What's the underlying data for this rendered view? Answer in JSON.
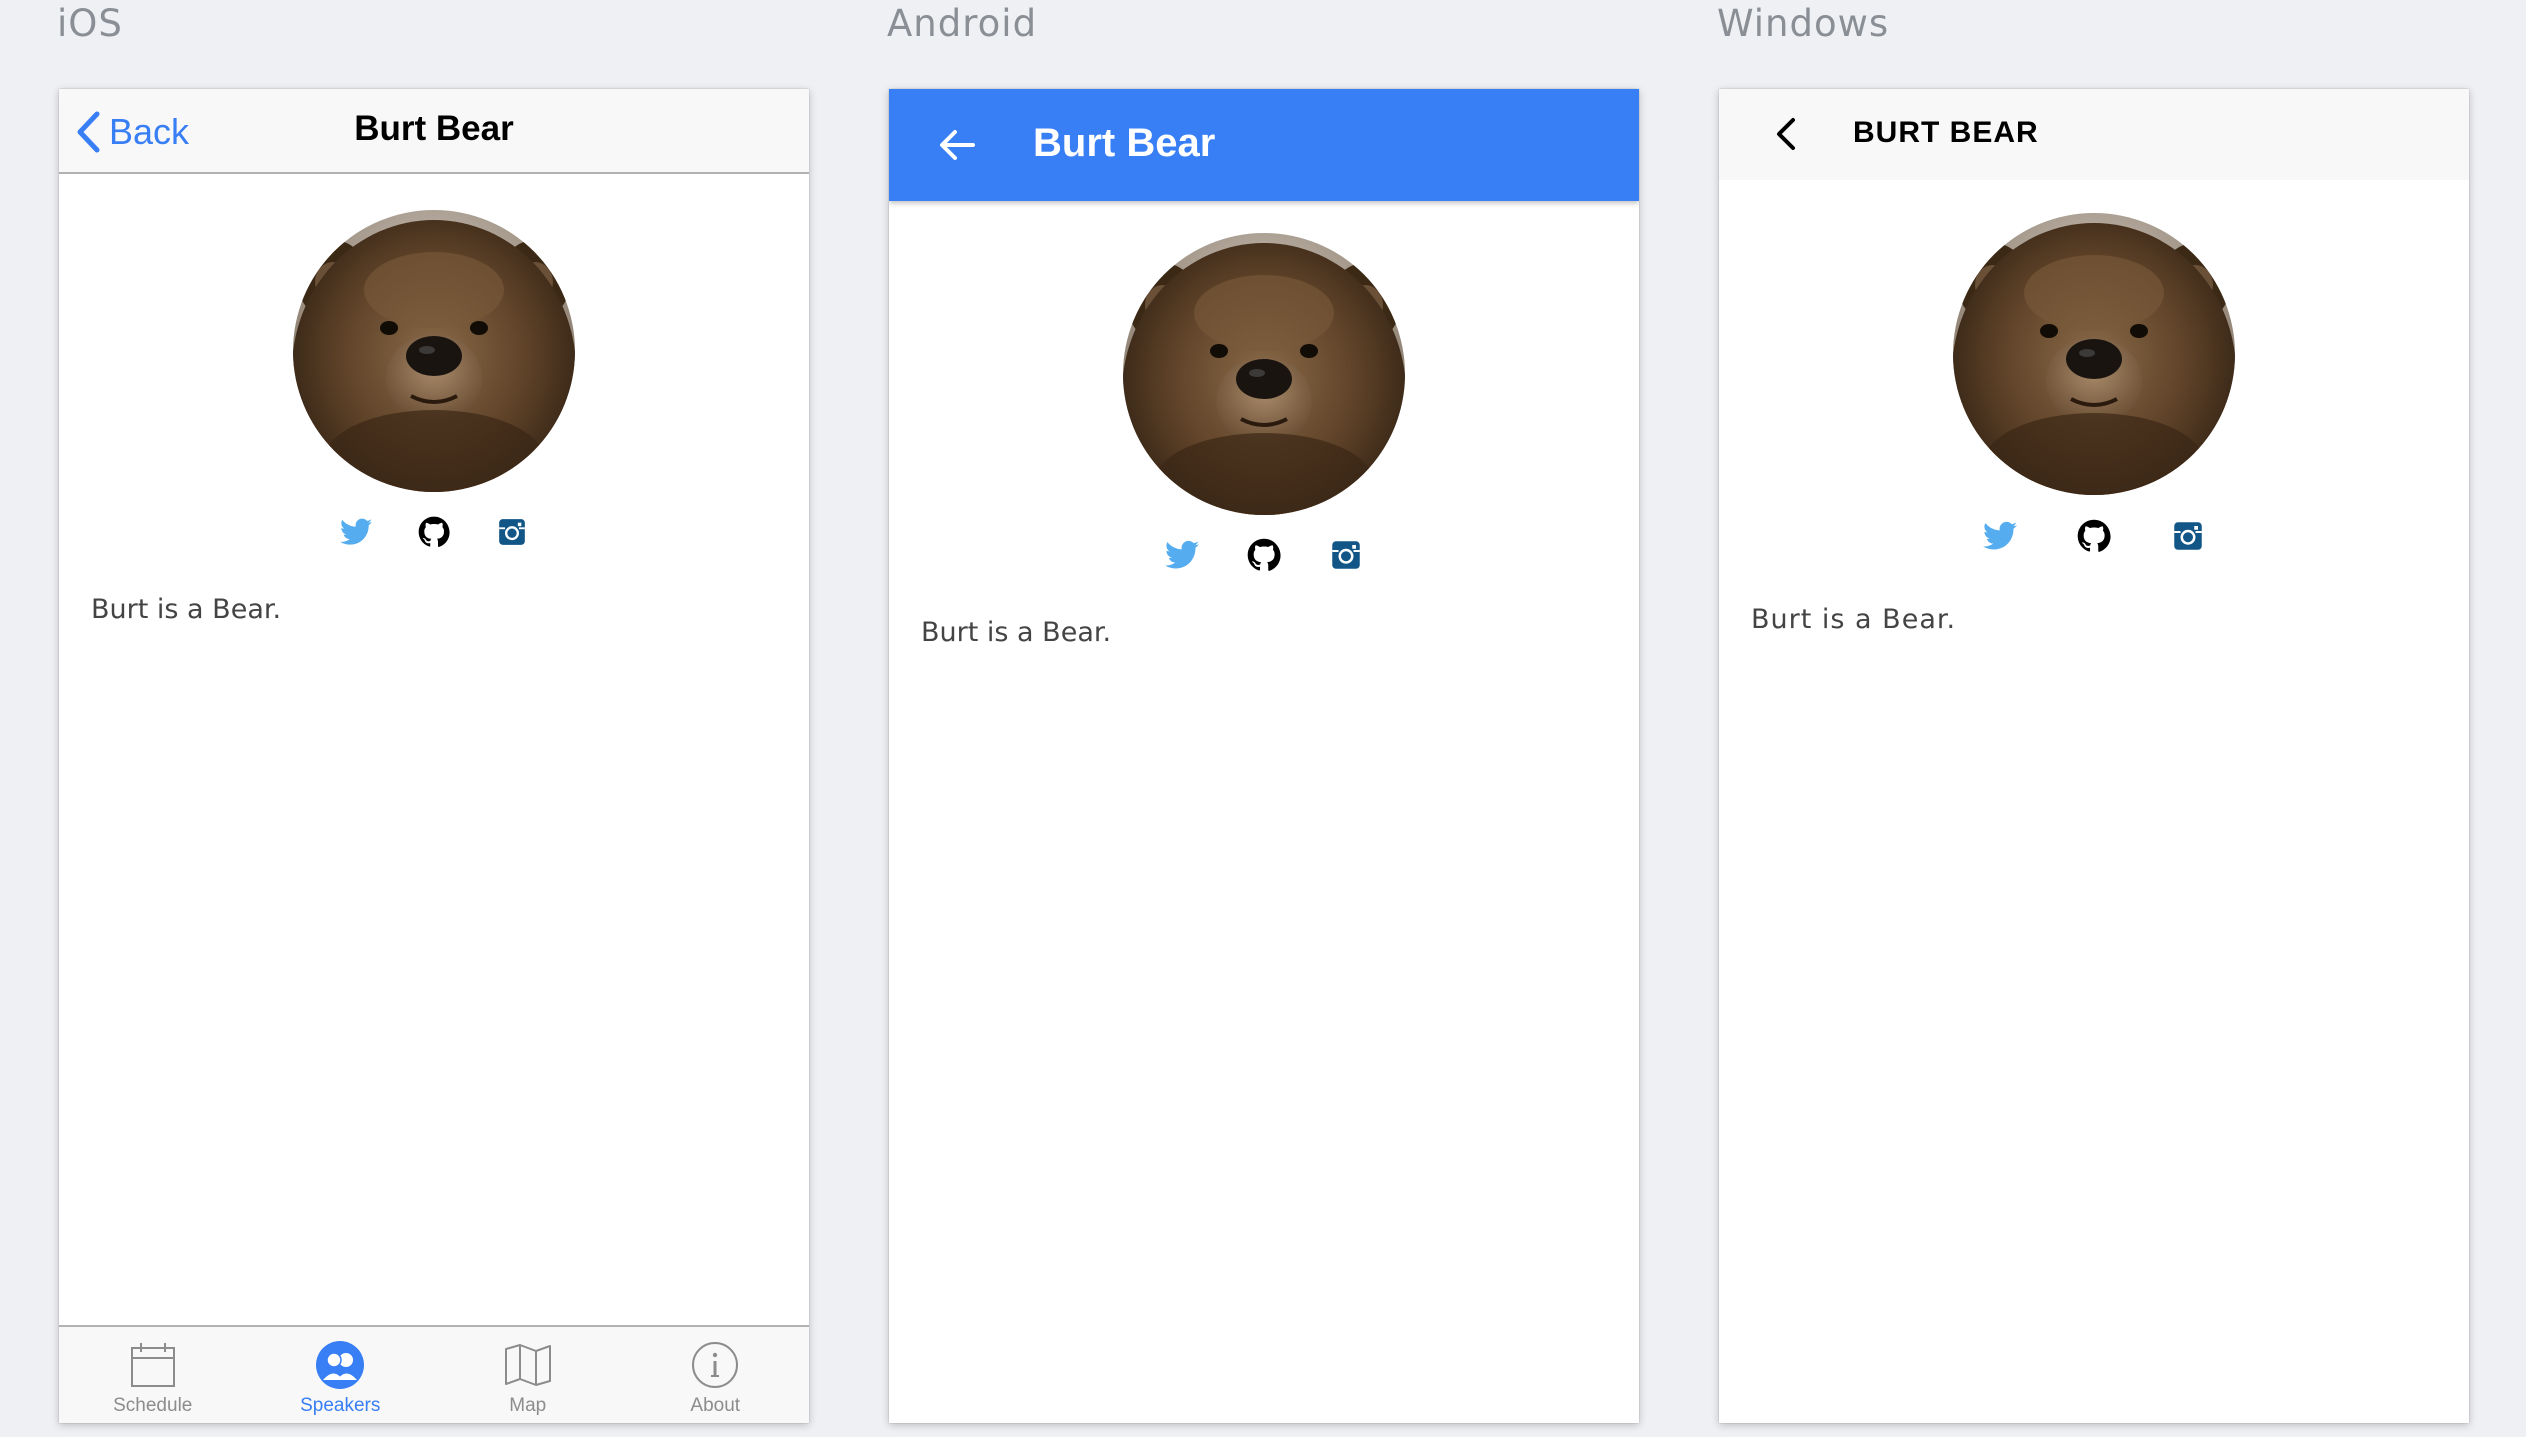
{
  "labels": {
    "ios": "iOS",
    "android": "Android",
    "windows": "Windows"
  },
  "speaker": {
    "name": "Burt Bear",
    "name_upper": "BURT BEAR",
    "bio": "Burt is a Bear."
  },
  "ios": {
    "back_label": "Back",
    "tabs": [
      {
        "label": "Schedule",
        "icon": "calendar-icon",
        "active": false
      },
      {
        "label": "Speakers",
        "icon": "people-icon",
        "active": true
      },
      {
        "label": "Map",
        "icon": "map-icon",
        "active": false
      },
      {
        "label": "About",
        "icon": "info-icon",
        "active": false
      }
    ]
  },
  "icons": {
    "back": "chevron-back-icon",
    "android_back": "arrow-back-icon",
    "social": [
      "twitter-icon",
      "github-icon",
      "instagram-icon"
    ]
  },
  "colors": {
    "accent": "#387ef5",
    "twitter": "#55acee",
    "instagram": "#125688",
    "github": "#000000",
    "background": "#eff0f4"
  }
}
